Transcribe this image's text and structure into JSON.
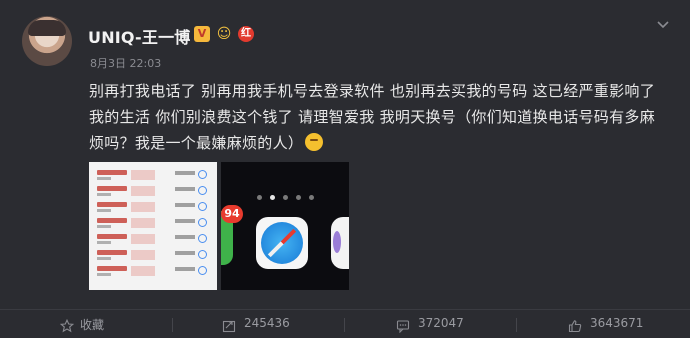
{
  "post": {
    "author": "UNIQ-王一博",
    "time": "8月3日 22:03",
    "badges": {
      "verified": "V",
      "member_face": "face-icon",
      "red_badge": "红"
    },
    "content": "别再打我电话了 别再用我手机号去登录软件 也别再去买我的号码 这已经严重影响了我的生活 你们别浪费这个钱了 请理智爱我 我明天换号（你们知道换电话号码有多麻烦吗？我是一个最嫌麻烦的人）",
    "images": [
      {
        "name": "call-log-screenshot"
      },
      {
        "name": "phone-homescreen-screenshot",
        "badge_count": "94"
      }
    ]
  },
  "actions": {
    "favorite": {
      "label": "收藏",
      "icon": "star-icon"
    },
    "repost": {
      "count": "245436",
      "icon": "repost-icon"
    },
    "comment": {
      "count": "372047",
      "icon": "comment-icon"
    },
    "like": {
      "count": "3643671",
      "icon": "thumbs-up-icon"
    }
  },
  "colors": {
    "background": "#2b2c31",
    "text": "#e8e8e8",
    "muted": "#8a8b91",
    "badge_red": "#e23a2e",
    "badge_gold": "#f6b83c"
  }
}
